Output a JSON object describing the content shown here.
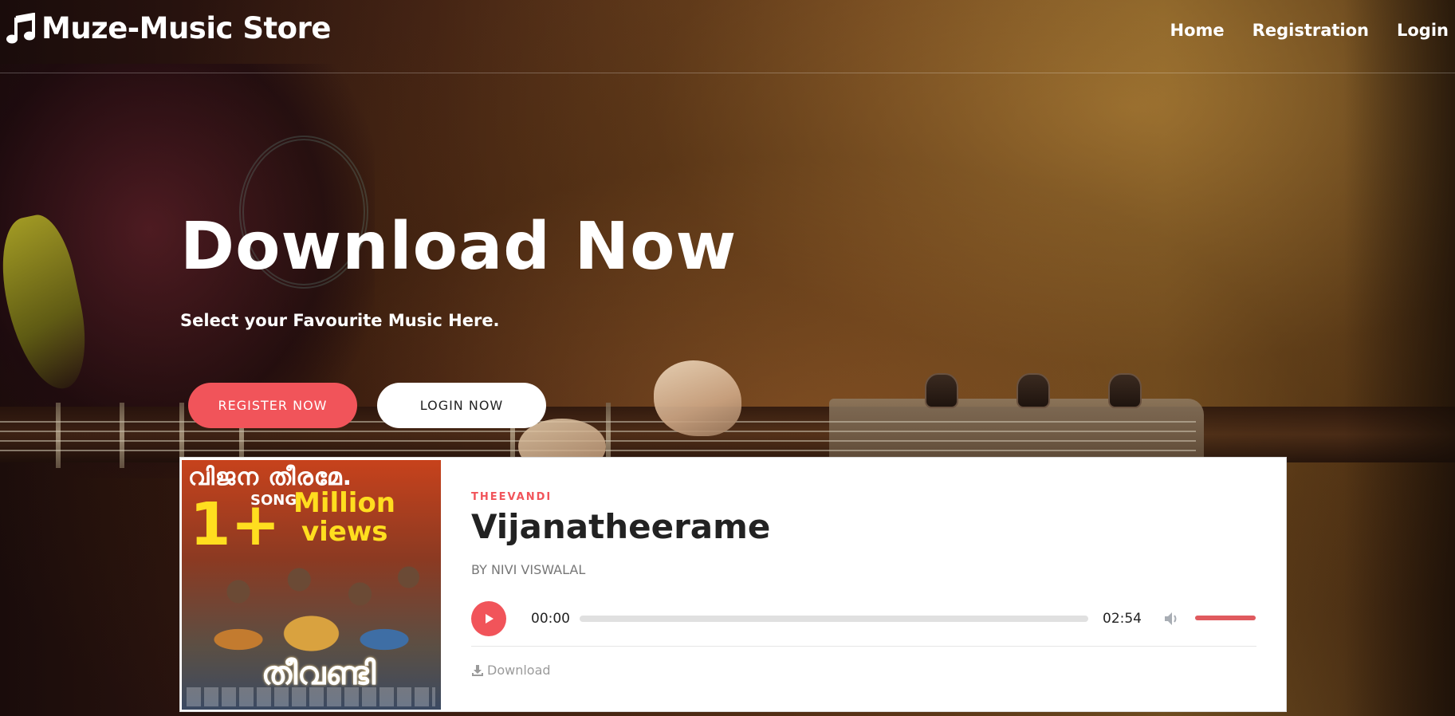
{
  "brand": {
    "name": "Muze-Music Store",
    "icon": "music-note-icon"
  },
  "nav": {
    "items": [
      {
        "label": "Home"
      },
      {
        "label": "Registration"
      },
      {
        "label": "Login"
      }
    ]
  },
  "hero": {
    "title": "Download Now",
    "subtitle": "Select your Favourite Music Here.",
    "register_button": "REGISTER NOW",
    "login_button": "LOGIN NOW"
  },
  "track": {
    "cover": {
      "top_text": "വിജന തീരമേ.",
      "big_text": "1+",
      "song_text": "SONG",
      "million_text": "Million",
      "views_text": "views",
      "title_text": "തീവണ്ടി"
    },
    "album": "THEEVANDI",
    "title": "Vijanatheerame",
    "artist": "BY NIVI VISWALAL",
    "player": {
      "current_time": "00:00",
      "total_time": "02:54",
      "progress": 0,
      "volume": 1.0
    },
    "download_label": "Download"
  },
  "colors": {
    "accent": "#f1545a",
    "muted_text": "#9b9b9b"
  }
}
